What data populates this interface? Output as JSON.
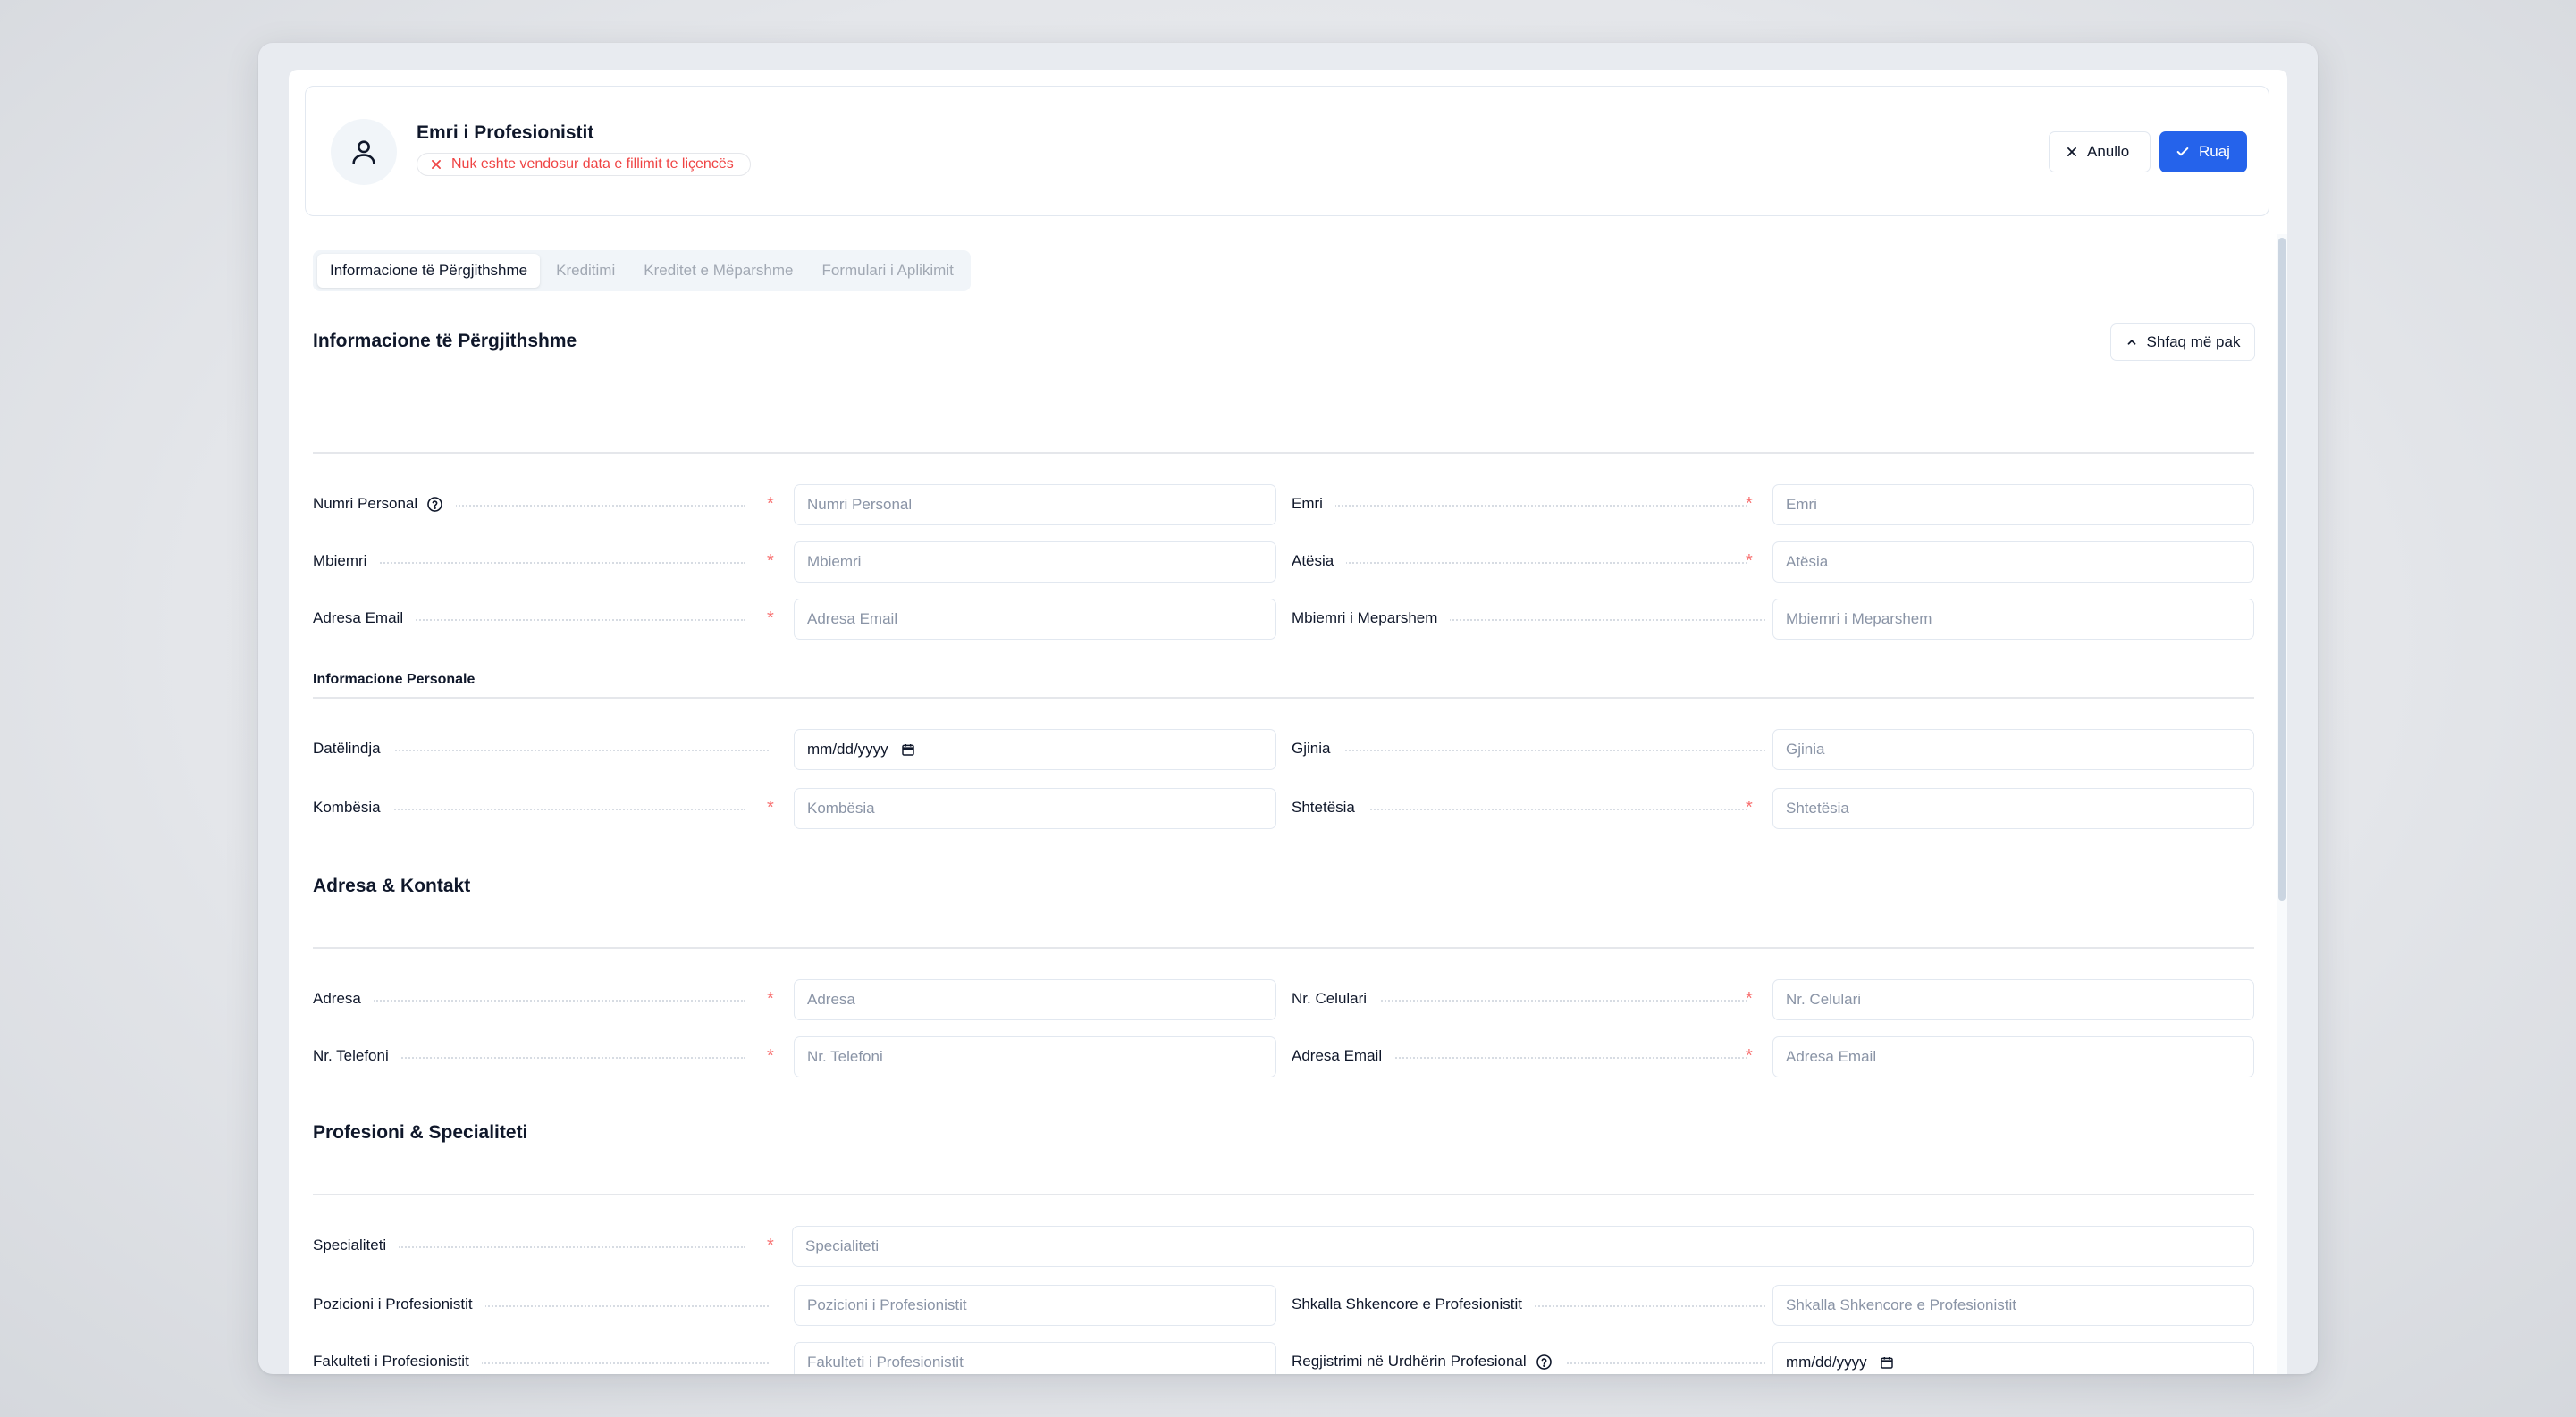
{
  "header": {
    "title": "Emri i Profesionistit",
    "warning": "Nuk eshte vendosur data e fillimit te liçencës",
    "cancel_label": "Anullo",
    "save_label": "Ruaj",
    "icons": {
      "avatar": "user-icon",
      "warning": "close-icon",
      "cancel": "close-icon",
      "save": "check-icon"
    }
  },
  "tabs": [
    {
      "label": "Informacione të Përgjithshme",
      "active": true
    },
    {
      "label": "Kreditimi",
      "active": false
    },
    {
      "label": "Kreditet e Mëparshme",
      "active": false
    },
    {
      "label": "Formulari i Aplikimit",
      "active": false
    }
  ],
  "general": {
    "title": "Informacione të Përgjithshme",
    "toggle_label": "Shfaq më pak",
    "fields": {
      "personal_number": {
        "label": "Numri Personal",
        "placeholder": "Numri Personal"
      },
      "first_name": {
        "label": "Emri",
        "placeholder": "Emri"
      },
      "last_name": {
        "label": "Mbiemri",
        "placeholder": "Mbiemri"
      },
      "father_name": {
        "label": "Atësia",
        "placeholder": "Atësia"
      },
      "email": {
        "label": "Adresa Email",
        "placeholder": "Adresa Email"
      },
      "previous_last_name": {
        "label": "Mbiemri i Meparshem",
        "placeholder": "Mbiemri i Meparshem"
      }
    },
    "personal": {
      "title": "Informacione Personale",
      "birth_date": {
        "label": "Datëlindja",
        "value": "mm/dd/yyyy"
      },
      "gender": {
        "label": "Gjinia",
        "placeholder": "Gjinia"
      },
      "nationality": {
        "label": "Kombësia",
        "placeholder": "Kombësia"
      },
      "citizenship": {
        "label": "Shtetësia",
        "placeholder": "Shtetësia"
      }
    }
  },
  "contact": {
    "title": "Adresa & Kontakt",
    "address": {
      "label": "Adresa",
      "placeholder": "Adresa"
    },
    "mobile": {
      "label": "Nr. Celulari",
      "placeholder": "Nr. Celulari"
    },
    "phone": {
      "label": "Nr. Telefoni",
      "placeholder": "Nr. Telefoni"
    },
    "email": {
      "label": "Adresa Email",
      "placeholder": "Adresa Email"
    }
  },
  "profession": {
    "title": "Profesioni & Specialiteti",
    "specialty": {
      "label": "Specialiteti",
      "placeholder": "Specialiteti"
    },
    "position": {
      "label": "Pozicioni i Profesionistit",
      "placeholder": "Pozicioni i Profesionistit"
    },
    "scientific_grade": {
      "label": "Shkalla Shkencore e Profesionistit",
      "placeholder": "Shkalla Shkencore e Profesionistit"
    },
    "faculty": {
      "label": "Fakulteti i Profesionistit",
      "placeholder": "Fakulteti i Profesionistit"
    },
    "registration": {
      "label": "Regjistrimi në Urdhërin Profesional",
      "value": "mm/dd/yyyy"
    }
  },
  "colors": {
    "primary": "#2563eb",
    "required": "#f87171",
    "warning": "#ef4444"
  }
}
